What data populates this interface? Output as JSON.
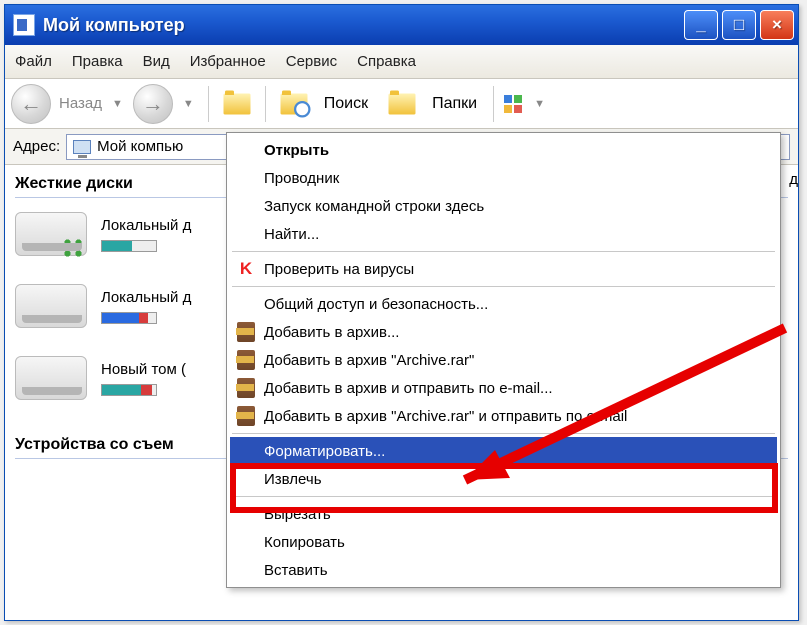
{
  "window": {
    "title": "Мой компьютер"
  },
  "menu": {
    "file": "Файл",
    "edit": "Правка",
    "view": "Вид",
    "favorites": "Избранное",
    "tools": "Сервис",
    "help": "Справка"
  },
  "toolbar": {
    "back": "Назад",
    "search": "Поиск",
    "folders": "Папки"
  },
  "addr": {
    "label": "Адрес:",
    "value": "Мой компью",
    "go_cut": "д"
  },
  "sections": {
    "hdd": "Жесткие диски",
    "removable": "Устройства со съем"
  },
  "drives": [
    {
      "label": "Локальный д",
      "fill": 0.55,
      "color": "bf-teal",
      "win": true
    },
    {
      "label": "Локальный д",
      "fill": 0.7,
      "color": "bf-blue",
      "red_tail": true
    },
    {
      "label": "Новый том (",
      "fill": 0.8,
      "color": "bf-teal",
      "red_tail": true
    }
  ],
  "context_menu": {
    "open": "Открыть",
    "explorer": "Проводник",
    "cmd_here": "Запуск командной строки здесь",
    "find": "Найти...",
    "virus": "Проверить на вирусы",
    "sharing": "Общий доступ и безопасность...",
    "rar_add": "Добавить в архив...",
    "rar_add_named": "Добавить в архив \"Archive.rar\"",
    "rar_mail": "Добавить в архив и отправить по e-mail...",
    "rar_mail_named": "Добавить в архив \"Archive.rar\" и отправить по e-mail",
    "format": "Форматировать...",
    "eject": "Извлечь",
    "cut": "Вырезать",
    "copy": "Копировать",
    "paste": "Вставить"
  }
}
